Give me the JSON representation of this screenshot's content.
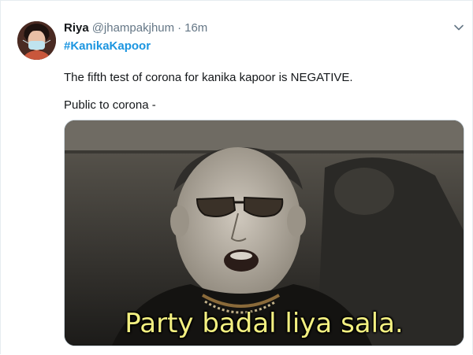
{
  "tweet": {
    "author_name": "Riya",
    "handle": "@jhampakjhum",
    "separator": "·",
    "timestamp": "16m",
    "hashtag": "#KanikaKapoor",
    "line1": "The fifth test of corona for kanika kapoor is NEGATIVE.",
    "line2": "Public to corona -",
    "media": {
      "caption": "Party badal liya sala."
    }
  },
  "icons": {
    "menu": "chevron-down-icon"
  },
  "colors": {
    "link": "#1b95e0",
    "text": "#14171a",
    "muted": "#657786",
    "subtitle": "#f3f081"
  }
}
